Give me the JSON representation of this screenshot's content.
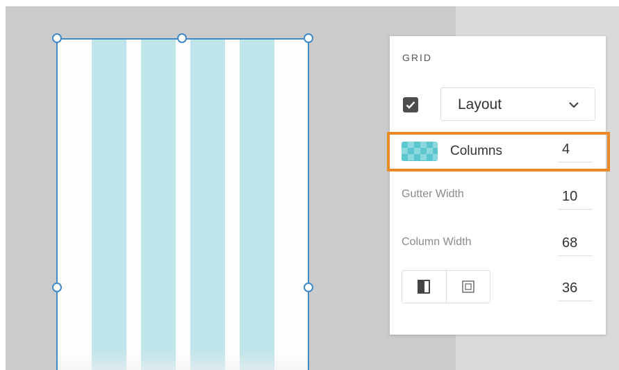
{
  "panel": {
    "title": "GRID",
    "layout_enabled": true,
    "dropdown": {
      "value": "Layout",
      "icon": "chevron-down-icon"
    },
    "columns": {
      "label": "Columns",
      "value": "4",
      "icon": "grid-swatch-icon"
    },
    "gutter_width": {
      "label": "Gutter Width",
      "value": "10"
    },
    "column_width": {
      "label": "Column Width",
      "value": "68"
    },
    "margin": {
      "value": "36",
      "icons": [
        "linked-margins-icon",
        "individual-margins-icon"
      ]
    }
  },
  "artboard": {
    "grid_columns": 4
  },
  "colors": {
    "selection": "#3f89c9",
    "highlight": "#e98a26",
    "grid_column": "#bfe4ea",
    "swatch": "#5cc6cf"
  }
}
